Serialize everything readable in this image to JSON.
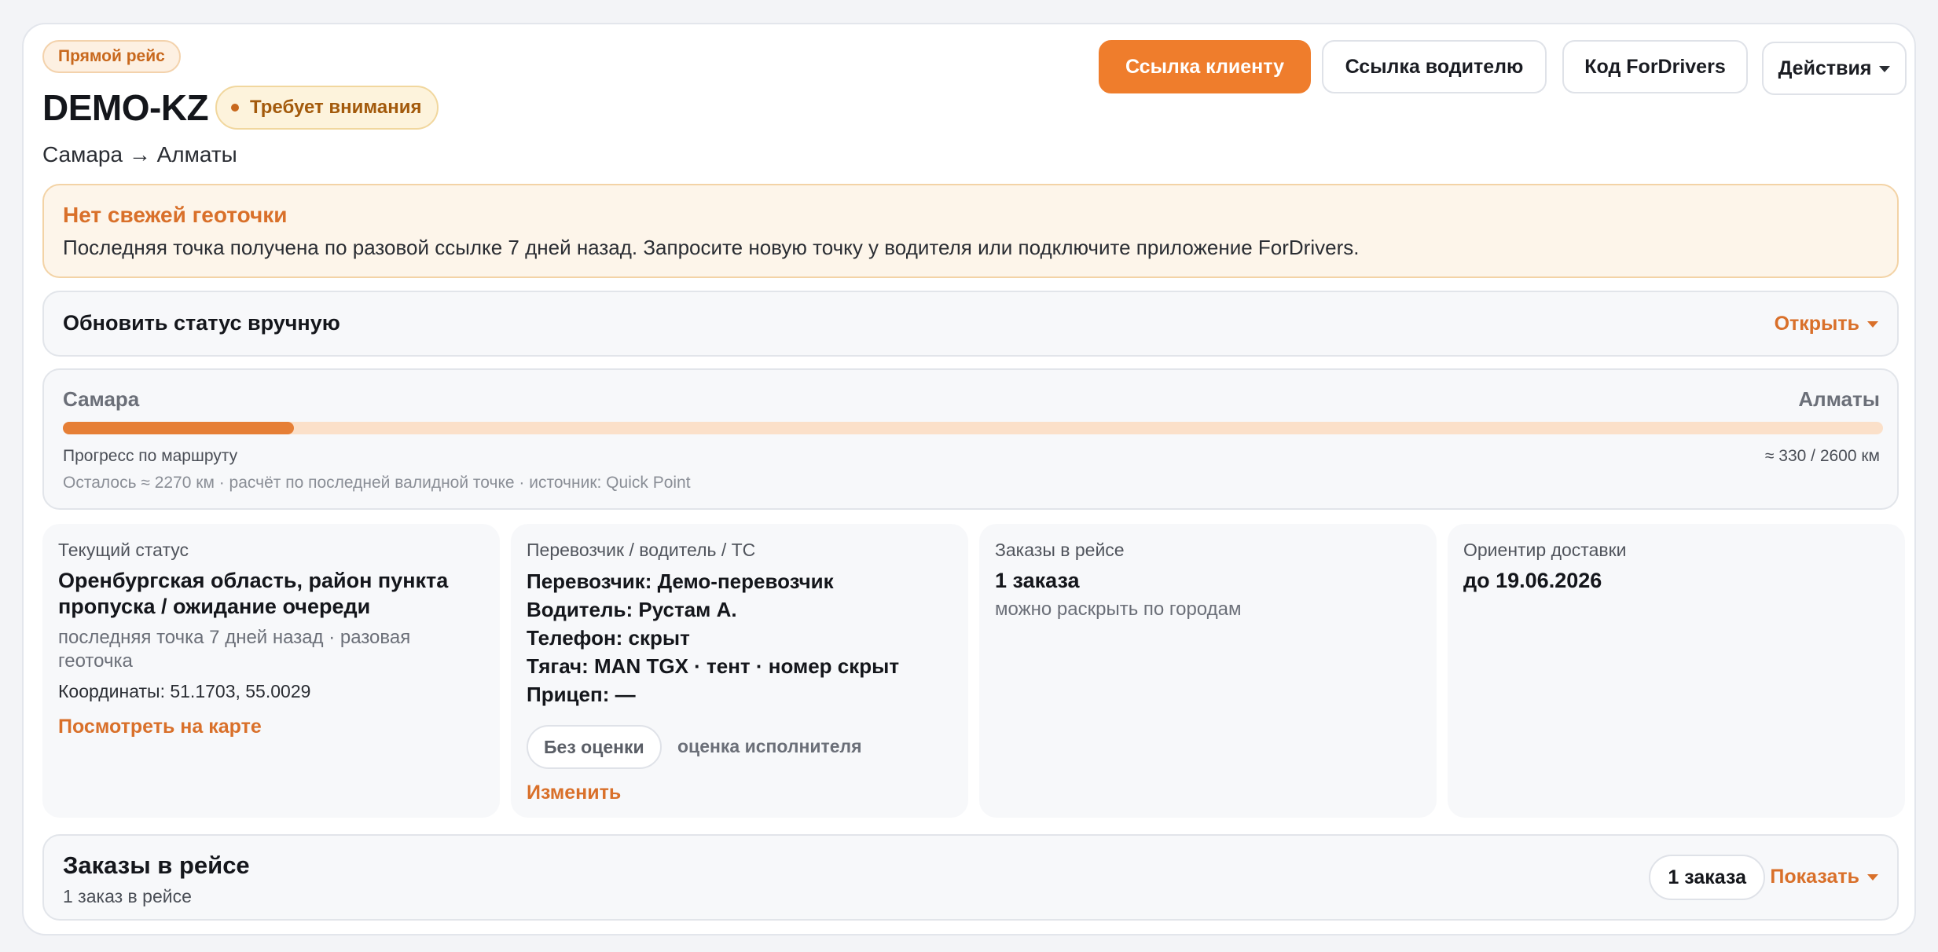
{
  "header": {
    "trip_type": "Прямой рейс",
    "trip_id": "DEMO-KZ",
    "attention": "Требует внимания",
    "route": "Самара → Алматы",
    "buttons": {
      "client_link": "Ссылка клиенту",
      "driver_link": "Ссылка водителю",
      "fordrivers_code": "Код ForDrivers",
      "actions": "Действия"
    }
  },
  "alert": {
    "title": "Нет свежей геоточки",
    "text": "Последняя точка получена по разовой ссылке 7 дней назад. Запросите новую точку у водителя или подключите приложение ForDrivers."
  },
  "manual_status": {
    "title": "Обновить статус вручную",
    "open": "Открыть"
  },
  "progress": {
    "from": "Самара",
    "to": "Алматы",
    "label": "Прогресс по маршруту",
    "value_text": "≈ 330 / 2600 км",
    "done_km": 330,
    "total_km": 2600,
    "sub": "Осталось ≈ 2270 км · расчёт по последней валидной точке · источник: Quick Point"
  },
  "cards": {
    "status": {
      "label": "Текущий статус",
      "main": "Оренбургская область, район пункта пропуска / ожидание очереди",
      "note": "последняя точка 7 дней назад · разовая геоточка",
      "coords": "Координаты: 51.1703, 55.0029",
      "map_link": "Посмотреть на карте"
    },
    "carrier": {
      "label": "Перевозчик / водитель / ТС",
      "carrier": "Перевозчик: Демо-перевозчик",
      "driver": "Водитель: Рустам А.",
      "phone": "Телефон: скрыт",
      "tractor": "Тягач: MAN TGX · тент · номер скрыт",
      "trailer": "Прицеп: —",
      "rating_chip": "Без оценки",
      "rating_label": "оценка исполнителя",
      "edit": "Изменить"
    },
    "orders": {
      "label": "Заказы в рейсе",
      "count": "1 заказа",
      "note": "можно раскрыть по городам"
    },
    "delivery": {
      "label": "Ориентир доставки",
      "date": "до 19.06.2026"
    }
  },
  "orders_section": {
    "title": "Заказы в рейсе",
    "sub": "1 заказ в рейсе",
    "chip": "1 заказа",
    "show": "Показать"
  },
  "colors": {
    "accent": "#ef7d2c",
    "accent_text": "#d9702a",
    "progress_track": "#fbe0c9",
    "progress_fill": "#e67f36"
  }
}
